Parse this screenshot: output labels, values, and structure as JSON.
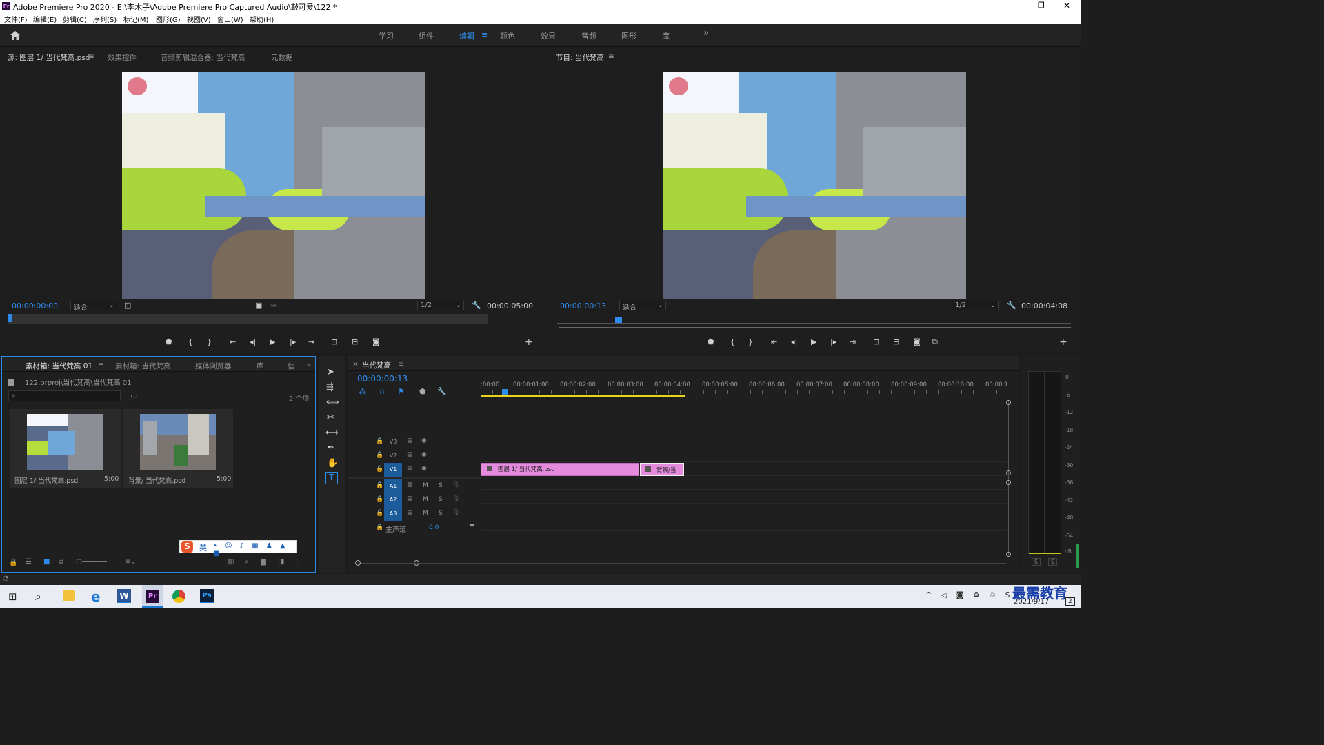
{
  "titlebar": {
    "title": "Adobe Premiere Pro 2020 - E:\\李木子\\Adobe Premiere Pro Captured Audio\\敲可爱\\122 *",
    "minimize": "–",
    "restore": "❐",
    "close": "✕"
  },
  "menu": [
    "文件(F)",
    "编辑(E)",
    "剪辑(C)",
    "序列(S)",
    "标记(M)",
    "图形(G)",
    "视图(V)",
    "窗口(W)",
    "帮助(H)"
  ],
  "workspaces": {
    "tabs": [
      "学习",
      "组件",
      "编辑",
      "颜色",
      "效果",
      "音频",
      "图形",
      "库"
    ],
    "active": "编辑",
    "more": "»",
    "menu_icon": "≡"
  },
  "source_panel": {
    "tabs": [
      "源: 图层 1/ 当代梵高.psd",
      "效果控件",
      "音频剪辑混合器: 当代梵高",
      "元数据"
    ],
    "timecode": "00:00:00:00",
    "fit": "适合",
    "resolution": "1/2",
    "duration": "00:00:05:00"
  },
  "program_panel": {
    "tab": "节目: 当代梵高",
    "timecode": "00:00:00:13",
    "fit": "适合",
    "resolution": "1/2",
    "duration": "00:00:04:08"
  },
  "project_panel": {
    "tabs": [
      "素材箱: 当代梵高 01",
      "素材箱: 当代梵高",
      "媒体浏览器",
      "库",
      "信"
    ],
    "path": "122.prproj\\当代梵高\\当代梵高 01",
    "count": "2 个项",
    "items": [
      {
        "name": "图层 1/ 当代梵高.psd",
        "duration": "5:00"
      },
      {
        "name": "背景/ 当代梵高.psd",
        "duration": "5:00"
      }
    ]
  },
  "ime": {
    "label": "英",
    "logo": "S"
  },
  "timeline": {
    "tab": "当代梵高",
    "timecode": "00:00:00:13",
    "ruler": [
      ":00:00",
      "00:00:01:00",
      "00:00:02:00",
      "00:00:03:00",
      "00:00:04:00",
      "00:00:05:00",
      "00:00:06:00",
      "00:00:07:00",
      "00:00:08:00",
      "00:00:09:00",
      "00:00:10:00",
      "00:00:1"
    ],
    "video_tracks": [
      "V3",
      "V2",
      "V1"
    ],
    "audio_tracks": [
      "A1",
      "A2",
      "A3"
    ],
    "master": {
      "label": "主声道",
      "value": "0.0"
    },
    "clips": [
      {
        "label": "图层 1/ 当代梵高.psd",
        "track": "V1"
      },
      {
        "label": "背景/当",
        "track": "V1"
      }
    ],
    "audio_btns": {
      "mute": "M",
      "solo": "S"
    }
  },
  "audio_meter": {
    "scale": [
      "0",
      "-6",
      "-12",
      "-18",
      "-24",
      "-30",
      "-36",
      "-42",
      "-48",
      "-54",
      "dB"
    ],
    "solo": [
      "S",
      "S"
    ]
  },
  "taskbar": {
    "date": "2021/9/17",
    "watermark": "最需教育",
    "notification": "2"
  },
  "colors": {
    "accent": "#2d8ceb",
    "clip": "#e58bde",
    "background": "#1d1d1d",
    "panel": "#232323"
  }
}
